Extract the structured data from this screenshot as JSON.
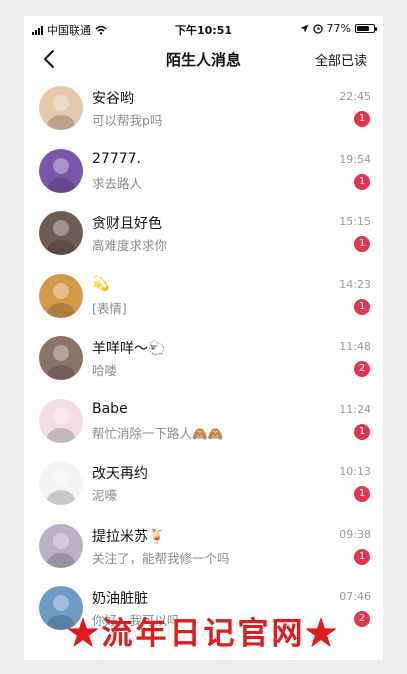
{
  "status_bar": {
    "carrier": "中国联通",
    "time": "下午10:51",
    "battery_text": "77%",
    "battery_level": 0.77
  },
  "nav": {
    "title": "陌生人消息",
    "action": "全部已读"
  },
  "conversations": [
    {
      "name": "安谷哟",
      "preview": "可以帮我p吗",
      "time": "22:45",
      "unread": "1",
      "avatar_color": "#e6c9a8"
    },
    {
      "name": "27777.",
      "preview": "求去路人",
      "time": "19:54",
      "unread": "1",
      "avatar_color": "#7a56a8"
    },
    {
      "name": "贪财且好色",
      "preview": "高难度求求你",
      "time": "15:15",
      "unread": "1",
      "avatar_color": "#6e5d52"
    },
    {
      "name": "💫",
      "preview": "[表情]",
      "time": "14:23",
      "unread": "1",
      "avatar_color": "#d49a4c"
    },
    {
      "name": "羊咩咩～🐑",
      "preview": "哈喽",
      "time": "11:48",
      "unread": "2",
      "avatar_color": "#8a7468"
    },
    {
      "name": "Babe",
      "preview": "帮忙消除一下路人🙈🙈",
      "time": "11:24",
      "unread": "1",
      "avatar_color": "#f2dde2"
    },
    {
      "name": "改天再约",
      "preview": "泥嚎",
      "time": "10:13",
      "unread": "1",
      "avatar_color": "#f4f4f4"
    },
    {
      "name": "提拉米苏🍹",
      "preview": "关注了，能帮我修一个吗",
      "time": "09:38",
      "unread": "1",
      "avatar_color": "#b9b2c4"
    },
    {
      "name": "奶油脏脏",
      "preview": "你好，我可以吗",
      "time": "07:46",
      "unread": "2",
      "avatar_color": "#6f9cc4"
    }
  ],
  "watermark": "★流年日记官网★"
}
